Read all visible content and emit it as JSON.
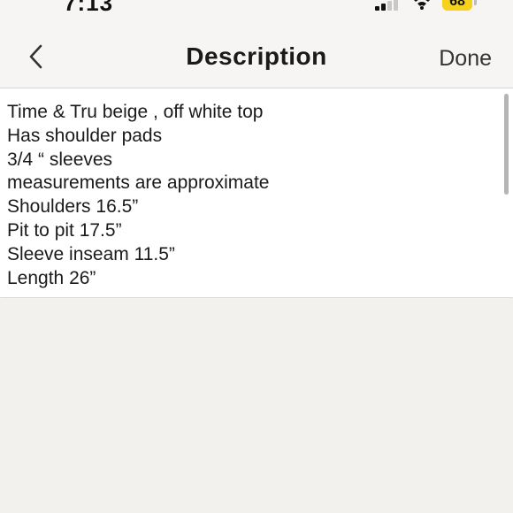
{
  "status_bar": {
    "time": "7:13",
    "battery_level": "68",
    "signal_bars": 2,
    "signal_total": 4
  },
  "nav": {
    "title": "Description",
    "done_label": "Done",
    "back_icon": "chevron-left-icon"
  },
  "description": {
    "lines": [
      "Time & Tru beige , off white top",
      "Has shoulder pads",
      "3/4 “ sleeves",
      "measurements are approximate",
      "Shoulders 16.5”",
      "Pit to pit 17.5”",
      "Sleeve inseam 11.5”",
      "Length 26”"
    ]
  },
  "colors": {
    "battery": "#f6d21e",
    "nav_background": "#f7f4f4",
    "page_background": "#f2f1ee",
    "text": "#1a1a1a"
  }
}
